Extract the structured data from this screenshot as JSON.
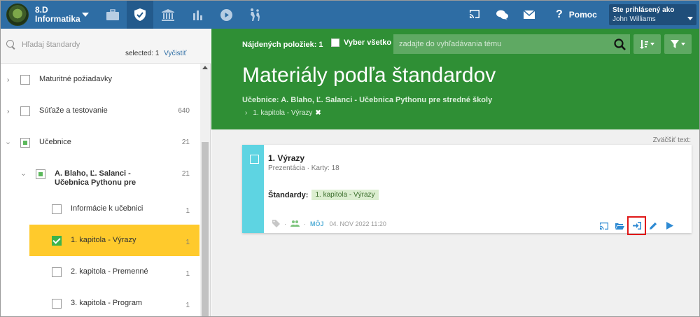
{
  "header": {
    "class_label": "8.D",
    "subject_label": "Informatika",
    "help_label": "Pomoc",
    "login_label": "Ste prihlásený ako",
    "user_name": "John Williams",
    "accent": "#2e6da4"
  },
  "sidebar": {
    "search_placeholder": "Hľadaj štandardy",
    "selected_label": "selected:",
    "selected_count": "1",
    "clear_label": "Vyčistiť",
    "items": [
      {
        "label": "Maturitné požiadavky",
        "count": ""
      },
      {
        "label": "Súťaže a testovanie",
        "count": "640"
      },
      {
        "label": "Učebnice",
        "count": "21"
      },
      {
        "label": "A. Blaho, Ľ. Salanci - Učebnica Pythonu pre",
        "count": "21"
      },
      {
        "label": "Informácie k učebnici",
        "count": "1"
      },
      {
        "label": "1. kapitola - Výrazy",
        "count": "1"
      },
      {
        "label": "2. kapitola - Premenné",
        "count": "1"
      },
      {
        "label": "3. kapitola - Program",
        "count": "1"
      }
    ]
  },
  "main": {
    "found_text": "Nájdených položiek: 1",
    "select_all_label": "Vyber všetko",
    "topic_placeholder": "zadajte do vyhľadávania tému",
    "title": "Materiály podľa štandardov",
    "book_line": "Učebnice: A. Blaho, Ľ. Salanci - Učebnica Pythonu pre stredné školy",
    "chapter_filter": "1. kapitola - Výrazy",
    "zoom_label": "Zväčšiť text:",
    "hero_color": "#2f8f35"
  },
  "card": {
    "title": "1. Výrazy",
    "subtitle": "Prezentácia · Karty: 18",
    "standards_label": "Štandardy:",
    "standard_tag": "1. kapitola - Výrazy",
    "mine_label": "MÔJ",
    "date": "04. NOV 2022 11:20",
    "side_color": "#5ed4e2"
  }
}
